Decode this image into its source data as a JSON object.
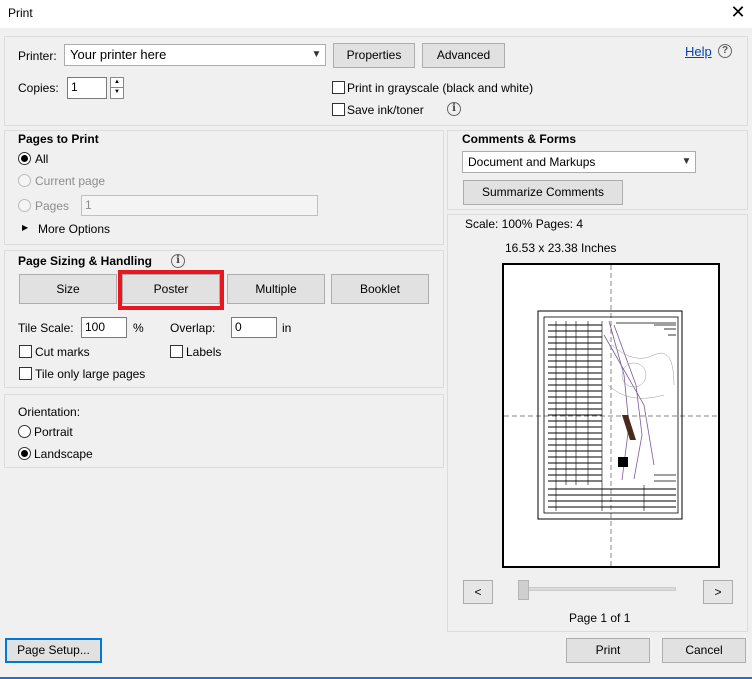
{
  "window": {
    "title": "Print",
    "close_glyph": "✕"
  },
  "printer": {
    "label": "Printer:",
    "value": "Your printer here",
    "properties_label": "Properties",
    "advanced_label": "Advanced",
    "help_label": "Help",
    "copies_label": "Copies:",
    "copies_value": "1",
    "grayscale_label": "Print in grayscale (black and white)",
    "save_ink_label": "Save ink/toner"
  },
  "pages_to_print": {
    "heading": "Pages to Print",
    "all_label": "All",
    "current_label": "Current page",
    "pages_label": "Pages",
    "pages_value": "1",
    "more_options_label": "More Options"
  },
  "sizing": {
    "heading": "Page Sizing & Handling",
    "tabs": [
      "Size",
      "Poster",
      "Multiple",
      "Booklet"
    ],
    "selected_tab": "Poster",
    "highlight_color": "#e8161f",
    "tile_scale_label": "Tile Scale:",
    "tile_scale_value": "100",
    "percent_label": "%",
    "overlap_label": "Overlap:",
    "overlap_value": "0",
    "overlap_unit": "in",
    "cut_marks_label": "Cut marks",
    "labels_label": "Labels",
    "tile_large_label": "Tile only large pages"
  },
  "orientation": {
    "heading": "Orientation:",
    "portrait_label": "Portrait",
    "landscape_label": "Landscape",
    "selected": "Landscape"
  },
  "comments": {
    "heading": "Comments & Forms",
    "value": "Document and Markups",
    "summarize_label": "Summarize Comments"
  },
  "preview": {
    "scale_text": "Scale: 100% Pages: 4",
    "size_text": "16.53 x 23.38 Inches",
    "prev_glyph": "<",
    "next_glyph": ">",
    "page_text": "Page 1 of 1"
  },
  "footer": {
    "page_setup_label": "Page Setup...",
    "print_label": "Print",
    "cancel_label": "Cancel"
  }
}
